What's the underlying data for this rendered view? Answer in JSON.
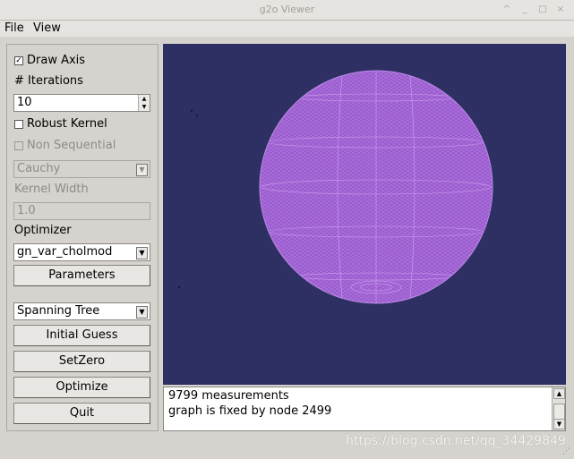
{
  "window": {
    "title": "g2o Viewer",
    "controls": [
      "^",
      "_",
      "□",
      "×"
    ]
  },
  "menu": [
    "File",
    "View"
  ],
  "panel": {
    "draw_axis": {
      "label": "Draw Axis",
      "checked": true
    },
    "iterations_label": "# Iterations",
    "iterations_value": "10",
    "robust_kernel": {
      "label": "Robust Kernel",
      "checked": false
    },
    "non_sequential": {
      "label": "Non Sequential",
      "checked": false,
      "enabled": false
    },
    "kernel_type": "Cauchy",
    "kernel_width_label": "Kernel Width",
    "kernel_width_value": "1.0",
    "optimizer_label": "Optimizer",
    "optimizer_value": "gn_var_cholmod",
    "parameters_button": "Parameters",
    "init_method": "Spanning Tree",
    "initial_guess_button": "Initial Guess",
    "setzero_button": "SetZero",
    "optimize_button": "Optimize",
    "quit_button": "Quit"
  },
  "viewport": {
    "background_color": "#2e2f62",
    "mesh_color": "#9a5ccd"
  },
  "log": [
    "9799 measurements",
    "graph is fixed by node 2499"
  ],
  "watermark": "https://blog.csdn.net/qq_34429849"
}
